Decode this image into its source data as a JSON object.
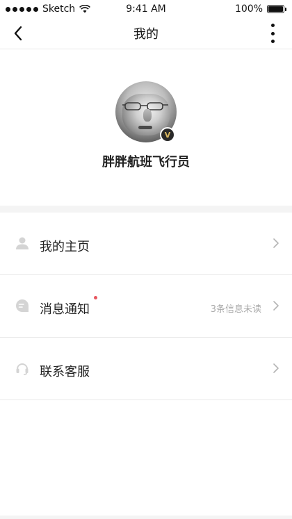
{
  "status_bar": {
    "carrier": "Sketch",
    "time": "9:41 AM",
    "battery": "100%"
  },
  "nav": {
    "title": "我的"
  },
  "profile": {
    "username": "胖胖航班飞行员",
    "badge": "V"
  },
  "menu": {
    "items": [
      {
        "label": "我的主页",
        "icon": "person-icon",
        "subtext": ""
      },
      {
        "label": "消息通知",
        "icon": "message-icon",
        "subtext": "3条信息未读",
        "unread_dot_color": "#e7565f"
      },
      {
        "label": "联系客服",
        "icon": "headset-icon",
        "subtext": ""
      }
    ]
  },
  "colors": {
    "icon_gray": "#d4d4d4",
    "chevron": "#b5b5b5",
    "subtext": "#aaaaaa",
    "badge_gold": "#d9b760"
  }
}
